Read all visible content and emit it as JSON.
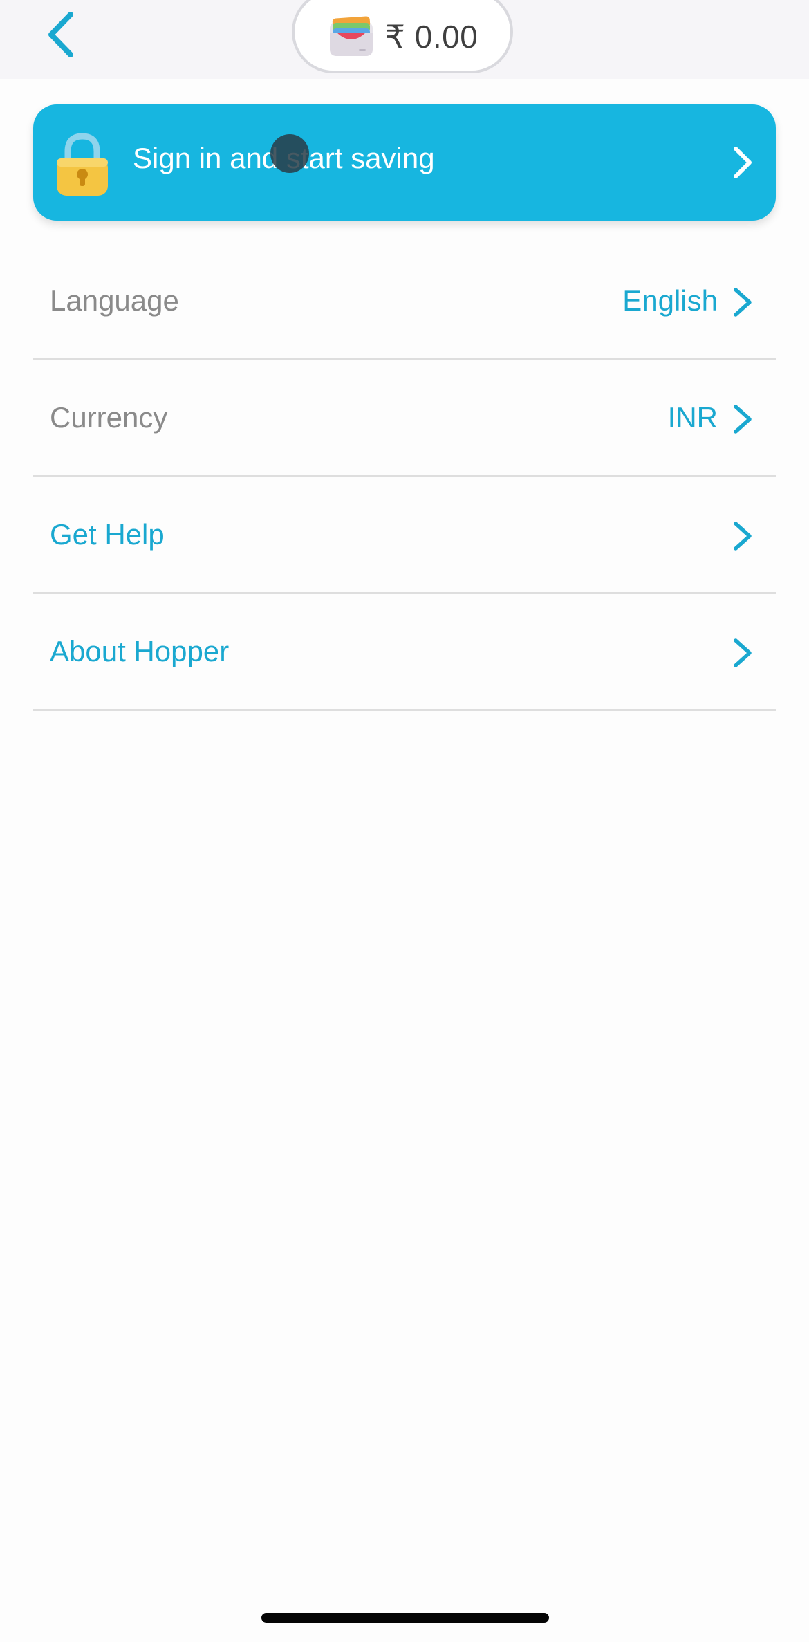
{
  "header": {
    "back_icon": "chevron-left-icon",
    "wallet_icon": "wallet-icon",
    "wallet_balance": "₹ 0.00"
  },
  "signin_banner": {
    "icon": "lock-icon",
    "label": "Sign in and start saving",
    "chevron_icon": "chevron-right-icon"
  },
  "settings": [
    {
      "label": "Language",
      "value": "English"
    },
    {
      "label": "Currency",
      "value": "INR"
    },
    {
      "label": "Get Help",
      "value": ""
    },
    {
      "label": "About Hopper",
      "value": ""
    }
  ],
  "colors": {
    "accent": "#17b6e0",
    "link": "#1aa8d0",
    "muted_label": "#8a8a8a",
    "header_bg": "#f6f5f8"
  }
}
